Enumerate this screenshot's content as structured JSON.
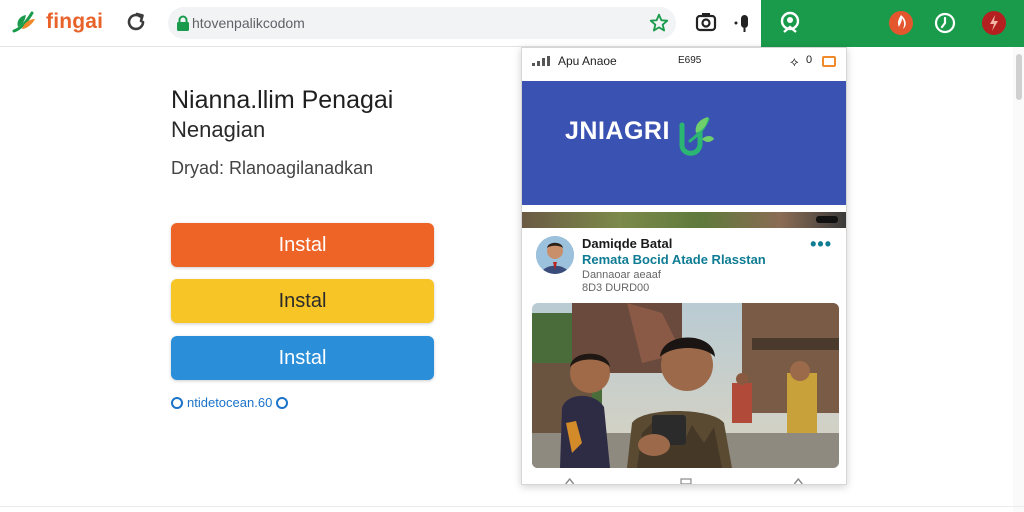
{
  "browser": {
    "brand_name": "fingai",
    "url": "htovenpalikcodom",
    "brand_color": "#e8622a",
    "accent_green": "#1a9b4b"
  },
  "hero": {
    "headline": "Niannа.llim Penagai",
    "subhead": "Nenagian",
    "detail": "Dryad: Rlanoagilanadkan"
  },
  "buttons": [
    {
      "label": "Instal",
      "color": "#ee6426"
    },
    {
      "label": "Instal",
      "color": "#f7c526"
    },
    {
      "label": "Instal",
      "color": "#2a8ed8"
    }
  ],
  "footer_link": "ntidetocean.60",
  "phone": {
    "status_title": "Apu Anaoe",
    "status_time": "E695",
    "status_num": "0",
    "banner_logo": "JNIAGRI",
    "banner_color": "#3a52b2",
    "post": {
      "author": "Damiqde Batal",
      "subtitle": "Remata Bocid Atade Rlasstan",
      "meta1": "Dannaoar aeaaf",
      "meta2": "8D3 DURD00"
    }
  }
}
